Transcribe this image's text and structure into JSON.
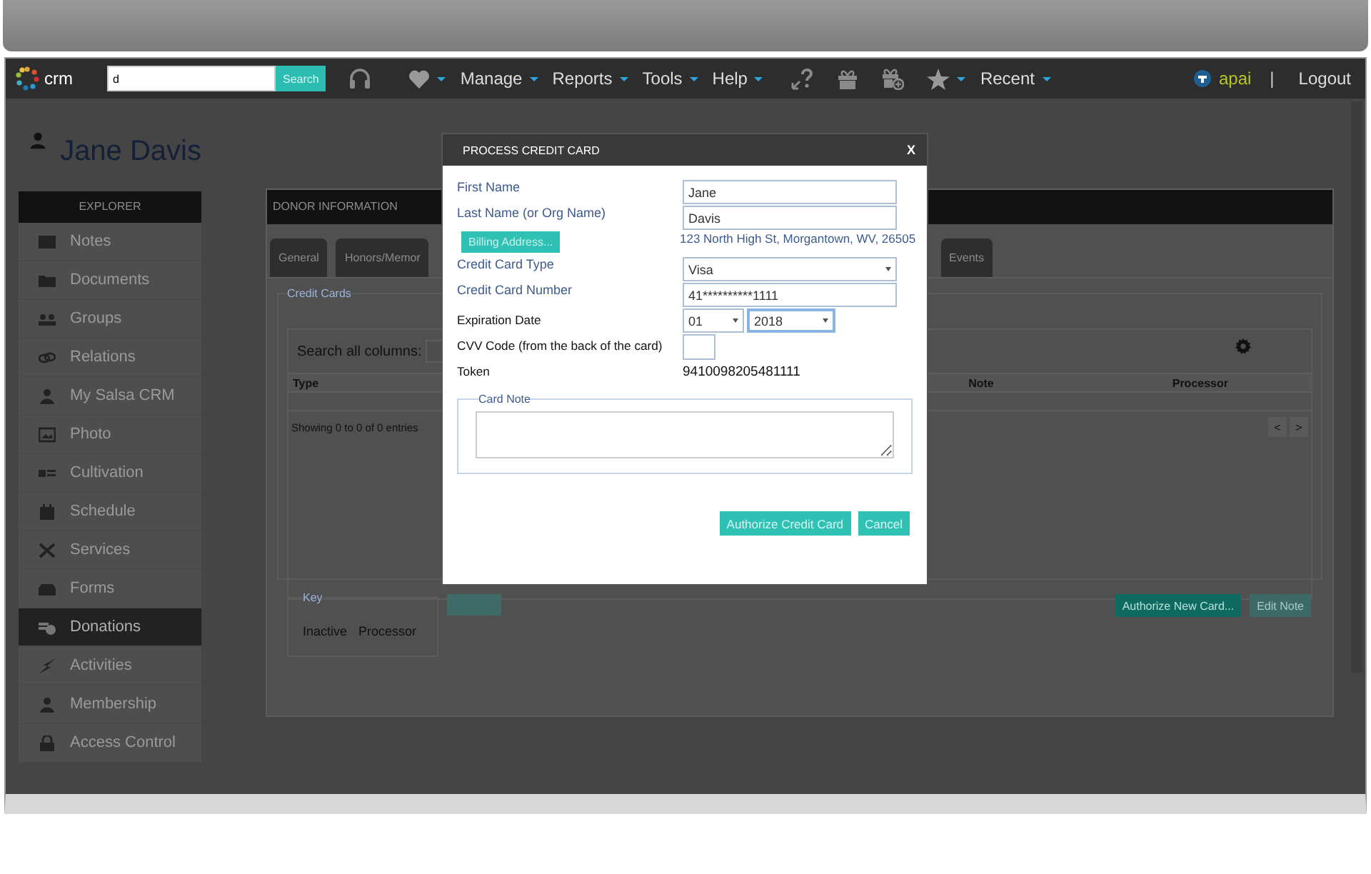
{
  "nav": {
    "logo": "crm",
    "search_value": "d",
    "search_button": "Search",
    "menus": [
      "Manage",
      "Reports",
      "Tools",
      "Help",
      "Recent"
    ],
    "user": "apai",
    "separator": "|",
    "logout": "Logout"
  },
  "profile": {
    "name": "Jane Davis"
  },
  "sidebar": {
    "title": "EXPLORER",
    "items": [
      {
        "label": "Notes",
        "selected": false
      },
      {
        "label": "Documents",
        "selected": false
      },
      {
        "label": "Groups",
        "selected": false
      },
      {
        "label": "Relations",
        "selected": false
      },
      {
        "label": "My Salsa CRM",
        "selected": false
      },
      {
        "label": "Photo",
        "selected": false
      },
      {
        "label": "Cultivation",
        "selected": false
      },
      {
        "label": "Schedule",
        "selected": false
      },
      {
        "label": "Services",
        "selected": false
      },
      {
        "label": "Forms",
        "selected": false
      },
      {
        "label": "Donations",
        "selected": true
      },
      {
        "label": "Activities",
        "selected": false
      },
      {
        "label": "Membership",
        "selected": false
      },
      {
        "label": "Access Control",
        "selected": false
      }
    ]
  },
  "donor": {
    "title": "DONOR INFORMATION",
    "tabs": [
      {
        "label": "General"
      },
      {
        "label": "Honors/Memor"
      },
      {
        "label": "Events"
      }
    ],
    "credit_cards": {
      "legend": "Credit Cards",
      "search_label": "Search all columns:",
      "columns": [
        "Type",
        "Note",
        "Processor"
      ],
      "info": "Showing 0 to 0 of 0 entries",
      "prev": "<",
      "next": ">"
    },
    "key": {
      "legend": "Key",
      "items": [
        "Inactive",
        "Processor"
      ]
    },
    "buttons": [
      {
        "label": "Authorize New Card...",
        "disabled": false
      },
      {
        "label": "Edit Note",
        "disabled": true
      }
    ]
  },
  "modal": {
    "title": "PROCESS CREDIT CARD",
    "close": "X",
    "fields": [
      {
        "kind": "text",
        "label": "First Name",
        "dark_label": false,
        "value": "Jane"
      },
      {
        "kind": "text",
        "label": "Last Name (or Org Name)",
        "dark_label": false,
        "value": "Davis"
      },
      {
        "kind": "address",
        "button": "Billing Address...",
        "value": "123 North High St, Morgantown, WV, 26505"
      },
      {
        "kind": "select",
        "label": "Credit Card Type",
        "dark_label": false,
        "value": "Visa"
      },
      {
        "kind": "text",
        "label": "Credit Card Number",
        "dark_label": false,
        "value": "41**********1111"
      },
      {
        "kind": "expiry",
        "label": "Expiration Date",
        "dark_label": true,
        "month": "01",
        "year": "2018",
        "year_focused": true
      },
      {
        "kind": "small",
        "label": "CVV Code (from the back of the card)",
        "dark_label": true
      },
      {
        "kind": "static",
        "label": "Token",
        "dark_label": true,
        "value": "9410098205481111"
      }
    ],
    "note_legend": "Card Note",
    "buttons": [
      "Authorize Credit Card",
      "Cancel"
    ]
  }
}
